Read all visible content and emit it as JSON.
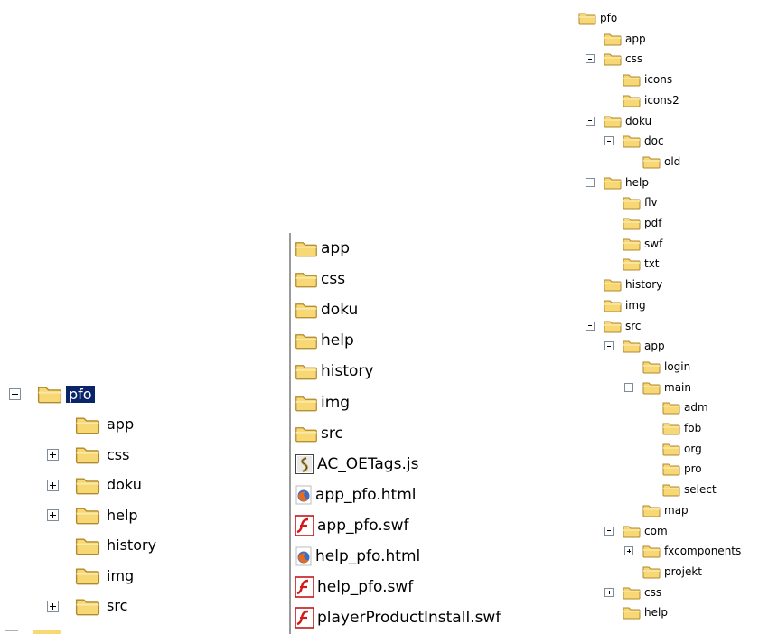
{
  "left_tree": {
    "items": [
      {
        "label": "pfo",
        "toggle": "minus",
        "selected": true
      },
      {
        "label": "app",
        "toggle": "none"
      },
      {
        "label": "css",
        "toggle": "plus"
      },
      {
        "label": "doku",
        "toggle": "plus"
      },
      {
        "label": "help",
        "toggle": "plus"
      },
      {
        "label": "history",
        "toggle": "none"
      },
      {
        "label": "img",
        "toggle": "none"
      },
      {
        "label": "src",
        "toggle": "plus"
      }
    ]
  },
  "file_list": {
    "items": [
      {
        "label": "app",
        "icon": "folder-icon"
      },
      {
        "label": "css",
        "icon": "folder-icon"
      },
      {
        "label": "doku",
        "icon": "folder-icon"
      },
      {
        "label": "help",
        "icon": "folder-icon"
      },
      {
        "label": "history",
        "icon": "folder-icon"
      },
      {
        "label": "img",
        "icon": "folder-icon"
      },
      {
        "label": "src",
        "icon": "folder-icon"
      },
      {
        "label": "AC_OETags.js",
        "icon": "script-file-icon"
      },
      {
        "label": "app_pfo.html",
        "icon": "firefox-html-icon"
      },
      {
        "label": "app_pfo.swf",
        "icon": "flash-swf-icon"
      },
      {
        "label": "help_pfo.html",
        "icon": "firefox-html-icon"
      },
      {
        "label": "help_pfo.swf",
        "icon": "flash-swf-icon"
      },
      {
        "label": "playerProductInstall.swf",
        "icon": "flash-swf-icon"
      }
    ]
  },
  "right_tree": {
    "items": [
      {
        "label": "pfo",
        "depth": 0,
        "toggle": "none"
      },
      {
        "label": "app",
        "depth": 1,
        "toggle": "none"
      },
      {
        "label": "css",
        "depth": 1,
        "toggle": "minus"
      },
      {
        "label": "icons",
        "depth": 2,
        "toggle": "none"
      },
      {
        "label": "icons2",
        "depth": 2,
        "toggle": "none"
      },
      {
        "label": "doku",
        "depth": 1,
        "toggle": "minus"
      },
      {
        "label": "doc",
        "depth": 2,
        "toggle": "minus"
      },
      {
        "label": "old",
        "depth": 3,
        "toggle": "none"
      },
      {
        "label": "help",
        "depth": 1,
        "toggle": "minus"
      },
      {
        "label": "flv",
        "depth": 2,
        "toggle": "none"
      },
      {
        "label": "pdf",
        "depth": 2,
        "toggle": "none"
      },
      {
        "label": "swf",
        "depth": 2,
        "toggle": "none"
      },
      {
        "label": "txt",
        "depth": 2,
        "toggle": "none"
      },
      {
        "label": "history",
        "depth": 1,
        "toggle": "none"
      },
      {
        "label": "img",
        "depth": 1,
        "toggle": "none"
      },
      {
        "label": "src",
        "depth": 1,
        "toggle": "minus"
      },
      {
        "label": "app",
        "depth": 2,
        "toggle": "minus"
      },
      {
        "label": "login",
        "depth": 3,
        "toggle": "none"
      },
      {
        "label": "main",
        "depth": 3,
        "toggle": "minus"
      },
      {
        "label": "adm",
        "depth": 4,
        "toggle": "none"
      },
      {
        "label": "fob",
        "depth": 4,
        "toggle": "none"
      },
      {
        "label": "org",
        "depth": 4,
        "toggle": "none"
      },
      {
        "label": "pro",
        "depth": 4,
        "toggle": "none"
      },
      {
        "label": "select",
        "depth": 4,
        "toggle": "none"
      },
      {
        "label": "map",
        "depth": 3,
        "toggle": "none"
      },
      {
        "label": "com",
        "depth": 2,
        "toggle": "minus"
      },
      {
        "label": "fxcomponents",
        "depth": 3,
        "toggle": "plus"
      },
      {
        "label": "projekt",
        "depth": 3,
        "toggle": "none"
      },
      {
        "label": "css",
        "depth": 2,
        "toggle": "plus"
      },
      {
        "label": "help",
        "depth": 2,
        "toggle": "none"
      }
    ]
  },
  "colors": {
    "selection": "#0a246a",
    "folder_fill": "#f8d775",
    "folder_stroke": "#b0892c"
  }
}
